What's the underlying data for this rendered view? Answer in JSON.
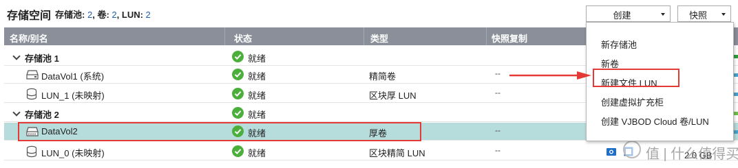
{
  "header": {
    "title": "存储空间",
    "summary": [
      {
        "key": "存储池:",
        "value": "2"
      },
      {
        "sep": ", "
      },
      {
        "key": "卷:",
        "value": "2"
      },
      {
        "sep": ", "
      },
      {
        "key": "LUN:",
        "value": "2"
      }
    ],
    "create_button": "创建",
    "snapshot_button": "快照"
  },
  "table": {
    "columns": [
      "名称/别名",
      "状态",
      "类型",
      "快照复制"
    ],
    "rows": [
      {
        "kind": "pool",
        "name": "存储池 1",
        "status": "就绪",
        "type": "",
        "snapshot": ""
      },
      {
        "kind": "volume",
        "name": "DataVol1 (系统)",
        "status": "就绪",
        "type": "精简卷",
        "snapshot": "--"
      },
      {
        "kind": "lun",
        "name": "LUN_1 (未映射)",
        "status": "就绪",
        "type": "区块厚 LUN",
        "snapshot": "--"
      },
      {
        "kind": "pool",
        "name": "存储池 2",
        "status": "就绪",
        "type": "",
        "snapshot": ""
      },
      {
        "kind": "volume",
        "name": "DataVol2",
        "status": "就绪",
        "type": "厚卷",
        "snapshot": "--",
        "selected": true
      },
      {
        "kind": "lun",
        "name": "LUN_0 (未映射)",
        "status": "就绪",
        "type": "区块精简 LUN",
        "snapshot": "--"
      }
    ]
  },
  "create_menu": {
    "items": [
      "新存储池",
      "新卷",
      "新建文件 LUN",
      "创建虚拟扩充柜",
      "创建 VJBOD Cloud 卷/LUN"
    ],
    "highlighted_index": 2
  },
  "watermark": {
    "text": "值 | 什么值得买"
  },
  "partial_size": "2.0 GB",
  "colors": {
    "header_bg": "#8a8f99",
    "selected_row": "#b7dcdc",
    "status_ok": "#4caf3c",
    "highlight": "#e53935",
    "summary_value": "#1f5fa8"
  }
}
